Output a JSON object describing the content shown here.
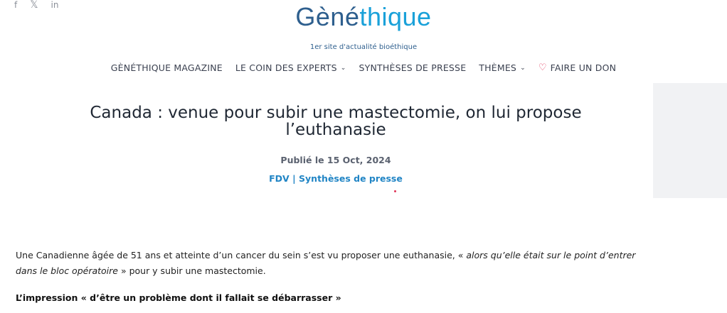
{
  "social": {
    "facebook": "f",
    "x": "𝕏",
    "linkedin": "in"
  },
  "brand": {
    "logo_part1": "Gèné",
    "logo_part2": "thique",
    "tagline": "1er site d'actualité bioéthique"
  },
  "nav": {
    "items": [
      {
        "label": "GÈNÉTHIQUE MAGAZINE",
        "has_chevron": false
      },
      {
        "label": "LE COIN DES EXPERTS",
        "has_chevron": true
      },
      {
        "label": "SYNTHÈSES DE PRESSE",
        "has_chevron": false
      },
      {
        "label": "THÈMES",
        "has_chevron": true
      },
      {
        "label": "FAIRE UN DON",
        "has_chevron": false,
        "icon": "heart-icon"
      }
    ],
    "chevron": "⌄",
    "heart": "♡"
  },
  "article": {
    "title_line1": "Canada : venue pour subir une mastectomie, on lui propose",
    "title_line2": "l’euthanasie",
    "date": "Publié le 15 Oct, 2024",
    "author": "FDV",
    "separator": "|",
    "category": "Synthèses de presse",
    "p1_start": "Une Canadienne âgée de 51 ans et atteinte d’un cancer du sein s’est vu proposer une euthanasie, « ",
    "p1_quote": "alors qu’elle était sur le point d’entrer dans le bloc opératoire",
    "p1_end": " » pour y subir une mastectomie.",
    "subhead": "L’impression « d’être un problème dont il fallait se débarrasser »"
  },
  "colors": {
    "brand_dark": "#2e5f8e",
    "brand_light": "#1aa1d9",
    "link": "#2185c5",
    "accent": "#e0365a"
  }
}
